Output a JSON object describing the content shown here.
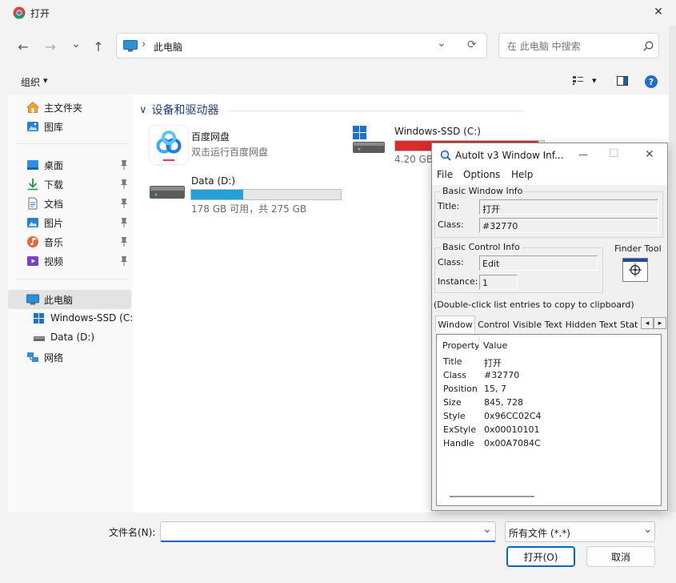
{
  "window": {
    "title": "打开",
    "close_glyph": "✕"
  },
  "nav": {
    "back": "←",
    "forward": "→",
    "recent": "⌄",
    "up": "↑"
  },
  "address": {
    "separator": "›",
    "location": "此电脑",
    "refresh": "⟳"
  },
  "search": {
    "placeholder": "在 此电脑 中搜索"
  },
  "command_bar": {
    "organize": "组织",
    "organize_caret": "▾",
    "view_caret": "▾",
    "help": "?"
  },
  "sidebar": {
    "items": [
      {
        "label": "主文件夹",
        "icon": "home-icon"
      },
      {
        "label": "图库",
        "icon": "gallery-icon"
      },
      {
        "label": "桌面",
        "icon": "desktop-icon"
      },
      {
        "label": "下载",
        "icon": "download-icon"
      },
      {
        "label": "文档",
        "icon": "document-icon"
      },
      {
        "label": "图片",
        "icon": "pictures-icon"
      },
      {
        "label": "音乐",
        "icon": "music-icon"
      },
      {
        "label": "视频",
        "icon": "video-icon"
      },
      {
        "label": "此电脑",
        "icon": "this-pc-icon"
      },
      {
        "label": "Windows-SSD (C:",
        "icon": "windows-drive-icon"
      },
      {
        "label": "Data (D:)",
        "icon": "drive-icon"
      },
      {
        "label": "网络",
        "icon": "network-icon"
      }
    ]
  },
  "main": {
    "section_caret": "∨",
    "section_title": "设备和驱动器",
    "baidu": {
      "name": "百度网盘",
      "subtitle": "双击运行百度网盘"
    },
    "drive_c": {
      "name": "Windows-SSD (C:)",
      "space": "4.20 GB",
      "used_fraction": 0.96,
      "bar_color": "#da2b2b"
    },
    "drive_d": {
      "name": "Data (D:)",
      "space": "178 GB 可用，共 275 GB",
      "used_fraction": 0.35,
      "bar_color": "#26a0da"
    }
  },
  "bottom": {
    "filename_label": "文件名(N):",
    "filename_value": "",
    "filter": "所有文件 (*.*)",
    "dropdown_caret": "⌄",
    "open_button": "打开(O)",
    "cancel_button": "取消"
  },
  "autoit": {
    "title": "AutoIt v3 Window Inf...",
    "min_glyph": "—",
    "max_glyph": "☐",
    "close_glyph": "✕",
    "menu": [
      "File",
      "Options",
      "Help"
    ],
    "basic_window_info": {
      "heading": "Basic Window Info",
      "title_label": "Title:",
      "title_value": "打开",
      "class_label": "Class:",
      "class_value": "#32770"
    },
    "basic_control_info": {
      "heading": "Basic Control Info",
      "class_label": "Class:",
      "class_value": "Edit",
      "instance_label": "Instance:",
      "instance_value": "1"
    },
    "finder_tool": {
      "label": "Finder Tool"
    },
    "hint": "(Double-click list entries to copy to clipboard)",
    "tabs": [
      "Window",
      "Control",
      "Visible Text",
      "Hidden Text",
      "Stat"
    ],
    "tab_prev": "◂",
    "tab_next": "▸",
    "columns": [
      "Property",
      "Value"
    ],
    "properties": [
      {
        "name": "Title",
        "value": "打开"
      },
      {
        "name": "Class",
        "value": "#32770"
      },
      {
        "name": "Position",
        "value": "15, 7"
      },
      {
        "name": "Size",
        "value": "845, 728"
      },
      {
        "name": "Style",
        "value": "0x96CC02C4"
      },
      {
        "name": "ExStyle",
        "value": "0x00010101"
      },
      {
        "name": "Handle",
        "value": "0x00A7084C"
      }
    ]
  }
}
